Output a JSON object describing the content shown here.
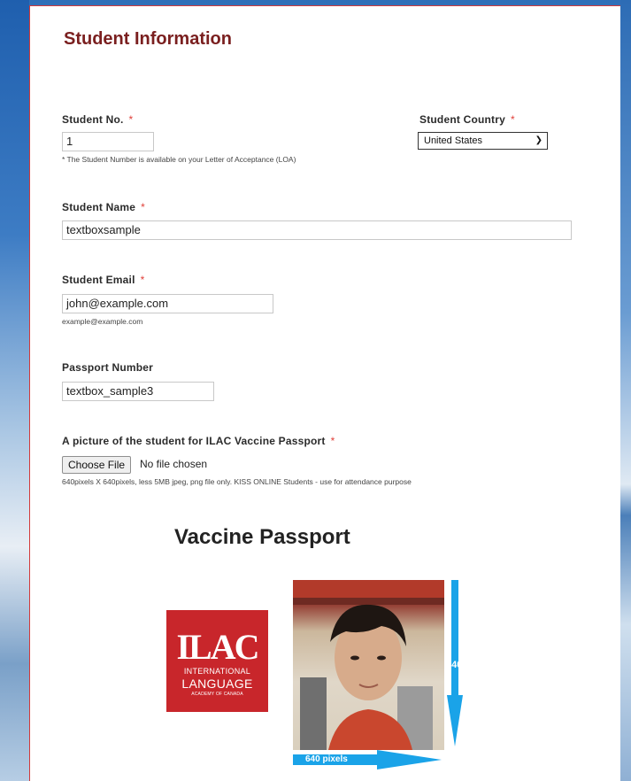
{
  "header": {
    "title": "Student Information"
  },
  "student_no": {
    "label": "Student No.",
    "required_mark": "*",
    "value": "1",
    "hint": "* The Student Number is available on your Letter of Acceptance (LOA)"
  },
  "student_country": {
    "label": "Student Country",
    "required_mark": "*",
    "selected": "United States"
  },
  "student_name": {
    "label": "Student Name",
    "required_mark": "*",
    "value": "textboxsample"
  },
  "student_email": {
    "label": "Student Email",
    "required_mark": "*",
    "value": "john@example.com",
    "hint": "example@example.com"
  },
  "passport": {
    "label": "Passport Number",
    "value": "textbox_sample3"
  },
  "picture": {
    "label": "A picture of the student for ILAC Vaccine Passport",
    "required_mark": "*",
    "button_label": "Choose File",
    "status": "No file chosen",
    "hint": "640pixels X 640pixels, less 5MB jpeg, png file only. KISS ONLINE Students - use for attendance purpose"
  },
  "sample": {
    "title": "Vaccine Passport",
    "logo": {
      "mark": "ILAC",
      "line1": "INTERNATIONAL",
      "line2": "LANGUAGE",
      "line3": "ACADEMY OF CANADA"
    },
    "height_label": "640",
    "width_label": "640 pixels"
  },
  "colors": {
    "title": "#7a1f1f",
    "required": "#e0403a",
    "logo_bg": "#c8262b",
    "arrow": "#1aa3e8",
    "card_border": "#d23a3a"
  },
  "icons": {
    "select": "chevron-down-icon",
    "height_arrow": "arrow-down-icon",
    "width_arrow": "arrow-right-icon"
  }
}
